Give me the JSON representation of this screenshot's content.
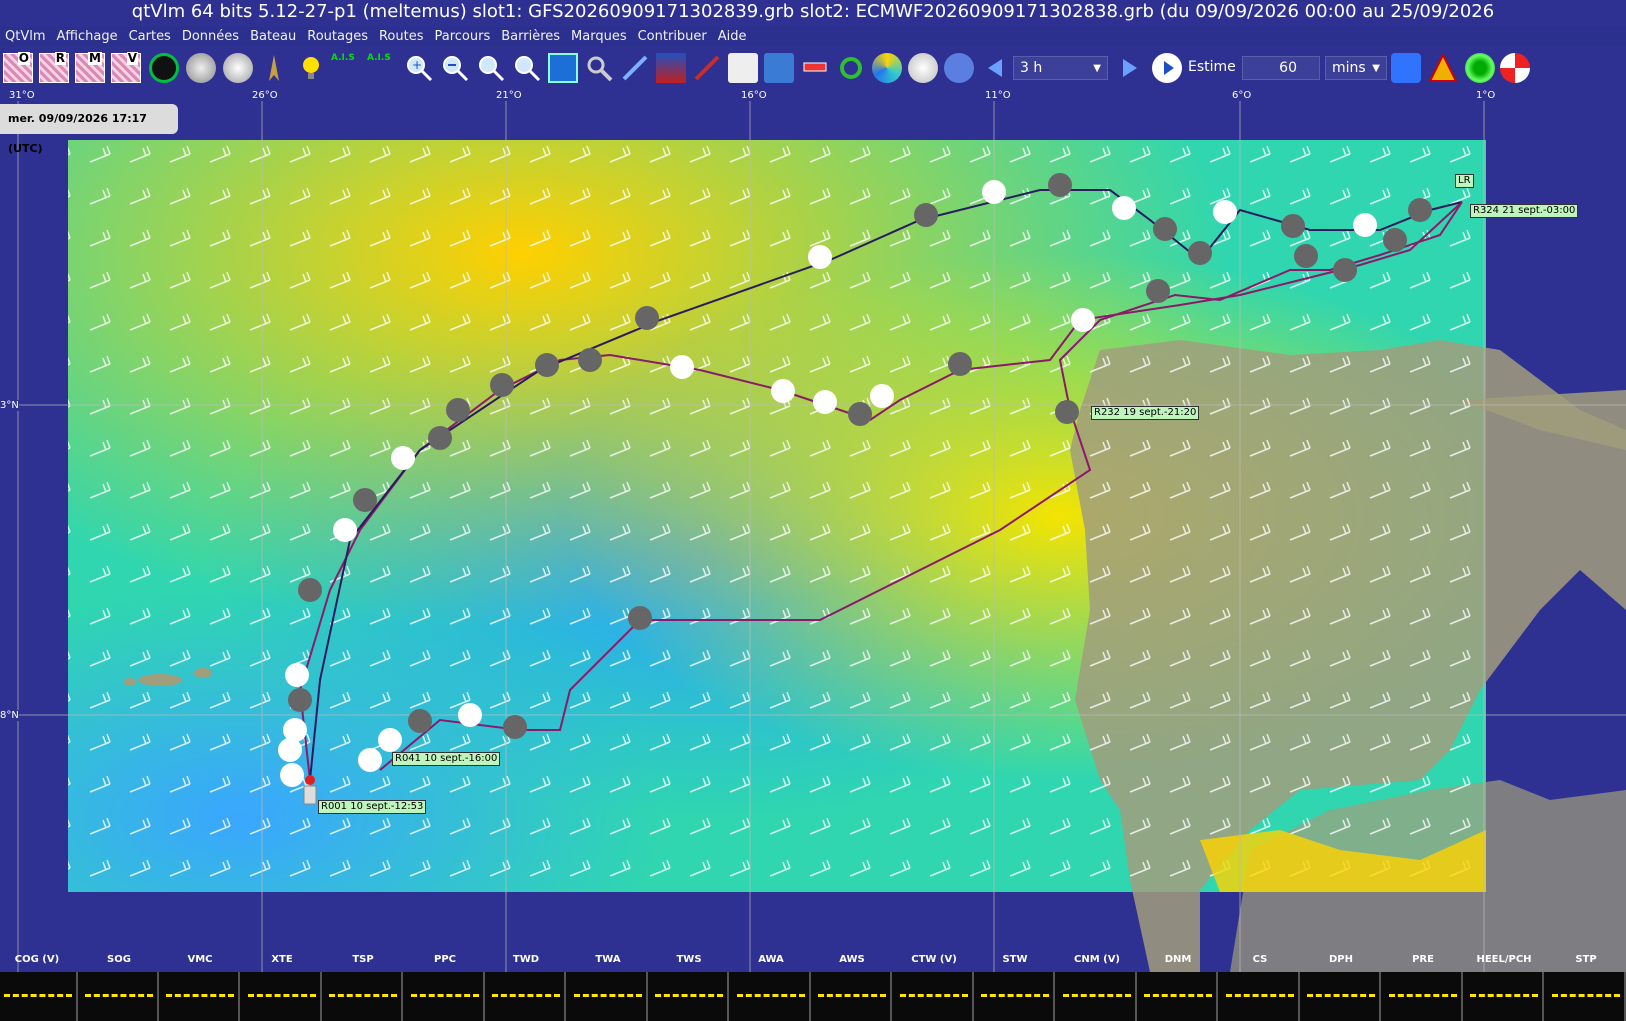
{
  "window": {
    "title": "qtVlm 64 bits 5.12-27-p1 (meltemus) slot1: GFS20260909171302839.grb slot2: ECMWF20260909171302838.grb (du 09/09/2026 00:00 au 25/09/2026"
  },
  "menu": [
    "QtVlm",
    "Affichage",
    "Cartes",
    "Données",
    "Bateau",
    "Routages",
    "Routes",
    "Parcours",
    "Barrières",
    "Marques",
    "Contribuer",
    "Aide"
  ],
  "toolbar": {
    "grib_letters": [
      "O",
      "R",
      "M",
      "V"
    ],
    "ais_label": "A.I.S",
    "step_value": "3 h",
    "estime_label": "Estime",
    "estime_value": "60",
    "estime_unit": "mins"
  },
  "map": {
    "date_label": "mer. 09/09/2026 17:17 (UTC)",
    "longitudes": [
      "31°O",
      "26°O",
      "21°O",
      "16°O",
      "11°O",
      "6°O",
      "1°O"
    ],
    "latitudes": [
      "3°N",
      "8°N"
    ],
    "route_labels": {
      "start": "R001 10 sept.-12:53",
      "r041": "R041 10 sept.-16:00",
      "r232": "R232 19 sept.-21:20",
      "r324": "R324 21 sept.-03:00",
      "lr": "LR"
    },
    "colors": {
      "ocean_edge": "#2e3192",
      "land": "#a19e7c",
      "route_purple": "#8b1a6b",
      "route_dark": "#2a1a5e"
    }
  },
  "status": {
    "columns": [
      "COG (V)",
      "SOG",
      "VMC",
      "XTE",
      "TSP",
      "PPC",
      "TWD",
      "TWA",
      "TWS",
      "AWA",
      "AWS",
      "CTW (V)",
      "STW",
      "CNM (V)",
      "DNM",
      "CS",
      "DPH",
      "PRE",
      "HEEL/PCH",
      "STP"
    ]
  }
}
